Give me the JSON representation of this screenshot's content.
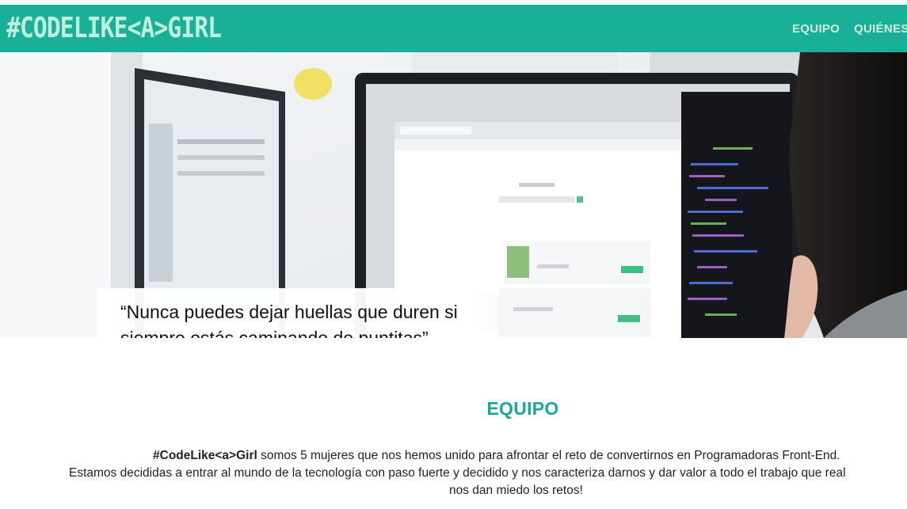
{
  "header": {
    "logo_text": "#CODELIKE<A>GIRL",
    "nav": [
      {
        "label": "EQUIPO"
      },
      {
        "label": "QUIÉNES"
      }
    ],
    "colors": {
      "bar": "#1aaf98",
      "logo": "#bff0de",
      "nav_text": "#cfeede"
    }
  },
  "hero": {
    "quote": "“Nunca puedes dejar huellas que duren si siempre estás caminando de puntitas”. – Leymah Gbowee"
  },
  "team_section": {
    "title": "EQUIPO",
    "title_color": "#1aa98f",
    "brand": "#CodeLike<a>Girl",
    "line1_rest": " somos 5 mujeres que nos hemos unido para afrontar el reto de convertirnos en Programadoras Front-End.",
    "line2": "Estamos decididas a entrar al mundo de la tecnología con paso fuerte y decidido y nos caracteriza darnos y dar valor a todo el trabajo que real",
    "line3": "nos dan miedo los retos!"
  }
}
